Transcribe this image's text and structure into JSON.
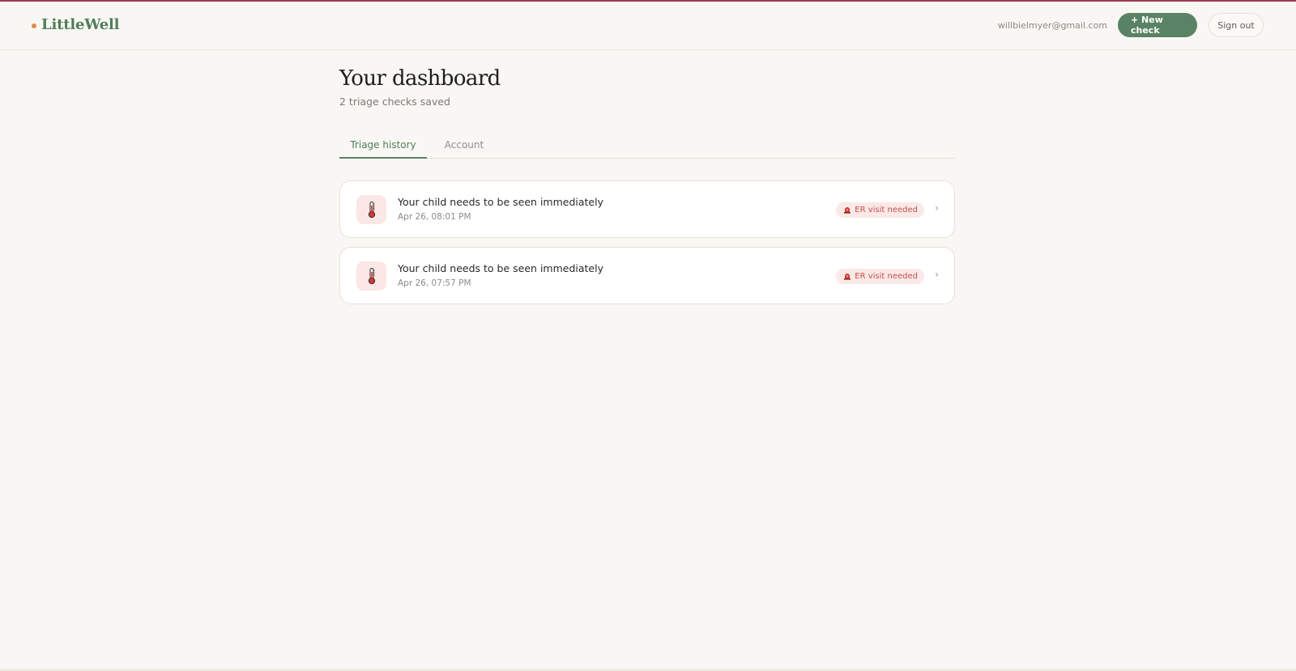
{
  "app": {
    "name": "LittleWell"
  },
  "header": {
    "user_email": "willbielmyer@gmail.com",
    "new_check_label": "+ New check",
    "sign_out_label": "Sign out"
  },
  "page": {
    "title": "Your dashboard",
    "subtitle": "2 triage checks saved"
  },
  "tabs": [
    {
      "label": "Triage history",
      "active": true
    },
    {
      "label": "Account",
      "active": false
    }
  ],
  "checks": [
    {
      "title": "Your child needs to be seen immediately",
      "date": "Apr 26, 08:01 PM",
      "badge": "ER visit needed",
      "icon": "thermometer-icon"
    },
    {
      "title": "Your child needs to be seen immediately",
      "date": "Apr 26, 07:57 PM",
      "badge": "ER visit needed",
      "icon": "thermometer-icon"
    }
  ],
  "colors": {
    "brand_green": "#5a8264",
    "accent_orange": "#e08a4c",
    "alert_red": "#c0504d",
    "background": "#f9f7f3"
  }
}
